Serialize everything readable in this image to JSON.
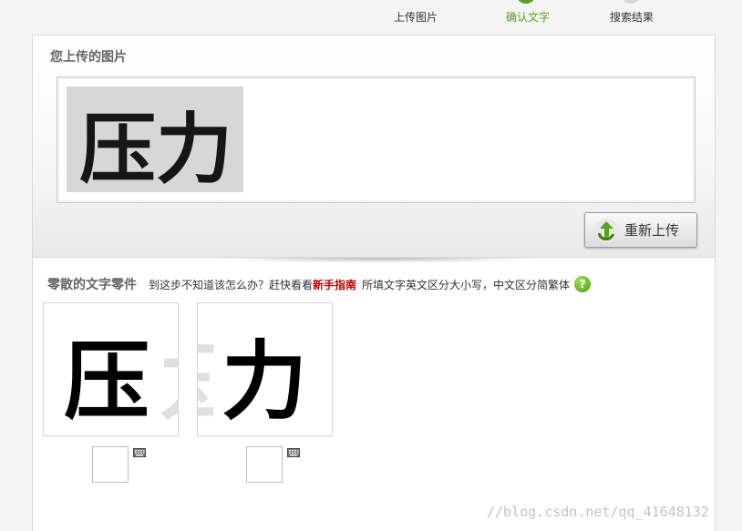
{
  "steps": [
    {
      "label": "上传图片",
      "state": "done"
    },
    {
      "label": "确认文字",
      "state": "active"
    },
    {
      "label": "搜索结果",
      "state": "pending"
    }
  ],
  "upload": {
    "title": "您上传的图片",
    "image_text": "压力",
    "reupload_label": "重新上传"
  },
  "pieces": {
    "title": "零散的文字零件",
    "hint": "到这步不知道该怎么办？赶快看看",
    "guide_link": "新手指南",
    "case_note": "所填文字英文区分大小写，中文区分简繁体",
    "help_glyph": "?",
    "items": [
      {
        "glyph": "压",
        "input_value": ""
      },
      {
        "glyph": "力",
        "input_value": ""
      }
    ]
  },
  "watermark": "//blog.csdn.net/qq_41648132",
  "colors": {
    "active_step": "#5aa21a",
    "link": "#c00000",
    "icon_green": "#4d9a12"
  }
}
